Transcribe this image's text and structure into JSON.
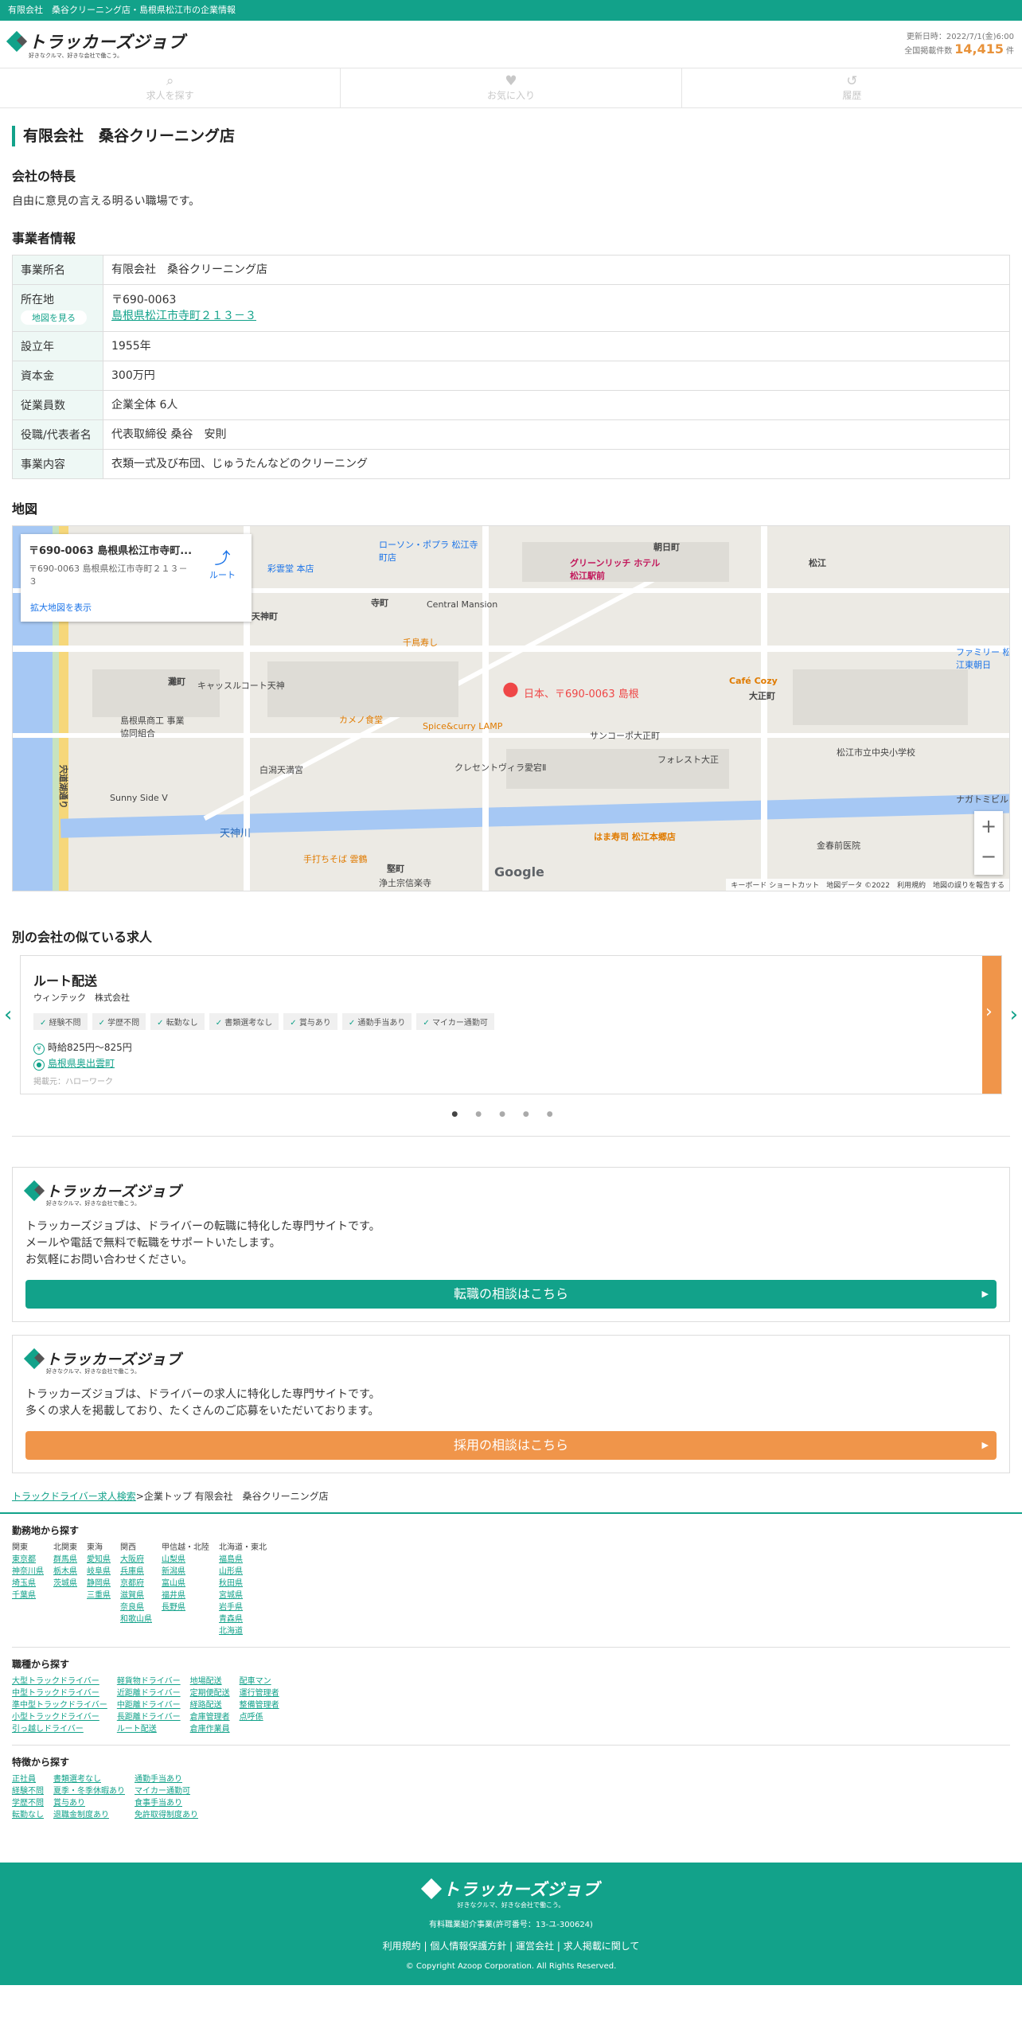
{
  "topbar": {
    "text": "有限会社　桑谷クリーニング店・島根県松江市の企業情報"
  },
  "header": {
    "logo_text": "トラッカーズジョブ",
    "logo_tagline": "好きなクルマ、好きな会社で働こう。",
    "updated": "更新日時：2022/7/1(金)6:00",
    "count_label": "全国掲載件数",
    "count": "14,415",
    "count_unit": "件"
  },
  "nav": [
    {
      "label": "求人を探す",
      "icon": "search-icon"
    },
    {
      "label": "お気に入り",
      "icon": "heart-icon"
    },
    {
      "label": "履歴",
      "icon": "history-icon"
    }
  ],
  "company": {
    "title": "有限会社　桑谷クリーニング店",
    "feature_heading": "会社の特長",
    "feature_text": "自由に意見の言える明るい職場です。",
    "info_heading": "事業者情報",
    "rows": [
      {
        "label": "事業所名",
        "value": "有限会社　桑谷クリーニング店"
      },
      {
        "label": "所在地",
        "zip": "〒690-0063",
        "address": "島根県松江市寺町２１３－３",
        "map_btn": "地図を見る"
      },
      {
        "label": "設立年",
        "value": "1955年"
      },
      {
        "label": "資本金",
        "value": "300万円"
      },
      {
        "label": "従業員数",
        "value": "企業全体 6人"
      },
      {
        "label": "役職/代表者名",
        "value": "代表取締役 桑谷　安則"
      },
      {
        "label": "事業内容",
        "value": "衣類一式及び布団、じゅうたんなどのクリーニング"
      }
    ]
  },
  "map": {
    "heading": "地図",
    "info_title": "〒690-0063 島根県松江市寺町...",
    "info_addr": "〒690-0063 島根県松江市寺町２１３－３",
    "route": "ルート",
    "enlarge": "拡大地図を表示",
    "pin_label": "日本、〒690-0063 島根",
    "footer": "キーボード ショートカット　地図データ ©2022　利用規約　地図の誤りを報告する",
    "google": "Google",
    "labels": [
      "朝日町",
      "天神町",
      "寺町",
      "灘町",
      "大正町",
      "松江",
      "Central Mansion",
      "天神川",
      "白潟天満宮",
      "Café Cozy",
      "グリーンリッチ ホテル 松江駅前",
      "ローソン・ポプラ 松江寺町店",
      "Spice&curry LAMP",
      "カメノ食堂",
      "はま寿司 松江本郷店",
      "手打ちそば 雲鶴",
      "浄土宗信楽寺",
      "宍道湖通り",
      "Sunny Side V",
      "サンコーポ大正町",
      "フォレスト大正",
      "クレセントヴィラ愛宕Ⅱ",
      "松江市立中央小学校",
      "ファミリー 松江東朝日",
      "彩雲堂 本店",
      "千鳥寿し",
      "キャッスルコート天神",
      "島根県商工 事業協同組合",
      "ナガトミビル",
      "堅町",
      "金春前医院"
    ]
  },
  "similar": {
    "heading": "別の会社の似ている求人",
    "job": "ルート配送",
    "company": "ウィンテック　株式会社",
    "tags": [
      "経験不問",
      "学歴不問",
      "転勤なし",
      "書類選考なし",
      "賞与あり",
      "通勤手当あり",
      "マイカー通勤可"
    ],
    "wage": "時給825円〜825円",
    "location": "島根県奥出雲町",
    "source": "掲載元：ハローワーク"
  },
  "promos": [
    {
      "text": [
        "トラッカーズジョブは、ドライバーの転職に特化した専門サイトです。",
        "メールや電話で無料で転職をサポートいたします。",
        "お気軽にお問い合わせください。"
      ],
      "button": "転職の相談はこちら",
      "color": "#12a28a"
    },
    {
      "text": [
        "トラッカーズジョブは、ドライバーの求人に特化した専門サイトです。",
        "多くの求人を掲載しており、たくさんのご応募をいただいております。"
      ],
      "button": "採用の相談はこちら",
      "color": "#f0954a"
    }
  ],
  "breadcrumb": {
    "link": "トラックドライバー求人検索",
    "rest": ">企業トップ 有限会社　桑谷クリーニング店"
  },
  "footnav": {
    "area": {
      "heading": "勤務地から探す",
      "cols": [
        {
          "h": "関東",
          "items": [
            "東京都",
            "神奈川県",
            "埼玉県",
            "千葉県"
          ]
        },
        {
          "h": "北関東",
          "items": [
            "群馬県",
            "栃木県",
            "茨城県"
          ]
        },
        {
          "h": "東海",
          "items": [
            "愛知県",
            "岐阜県",
            "静岡県",
            "三重県"
          ]
        },
        {
          "h": "関西",
          "items": [
            "大阪府",
            "兵庫県",
            "京都府",
            "滋賀県",
            "奈良県",
            "和歌山県"
          ]
        },
        {
          "h": "甲信越・北陸",
          "items": [
            "山梨県",
            "新潟県",
            "富山県",
            "福井県",
            "長野県"
          ]
        },
        {
          "h": "北海道・東北",
          "items": [
            "福島県",
            "山形県",
            "秋田県",
            "宮城県",
            "岩手県",
            "青森県",
            "北海道"
          ]
        }
      ]
    },
    "job": {
      "heading": "職種から探す",
      "cols": [
        {
          "items": [
            "大型トラックドライバー",
            "中型トラックドライバー",
            "準中型トラックドライバー",
            "小型トラックドライバー",
            "引っ越しドライバー"
          ]
        },
        {
          "items": [
            "軽貨物ドライバー",
            "近距離ドライバー",
            "中距離ドライバー",
            "長距離ドライバー",
            "ルート配送"
          ]
        },
        {
          "items": [
            "地場配送",
            "定期便配送",
            "経路配送",
            "倉庫管理者",
            "倉庫作業員"
          ]
        },
        {
          "items": [
            "配車マン",
            "運行管理者",
            "整備管理者",
            "点呼係"
          ]
        }
      ]
    },
    "feature": {
      "heading": "特徴から探す",
      "cols": [
        {
          "items": [
            "正社員",
            "経験不問",
            "学歴不問",
            "転勤なし"
          ]
        },
        {
          "items": [
            "書類選考なし",
            "夏季・冬季休暇あり",
            "賞与あり",
            "退職金制度あり"
          ]
        },
        {
          "items": [
            "通勤手当あり",
            "マイカー通勤可",
            "食事手当あり",
            "免許取得制度あり"
          ]
        }
      ]
    }
  },
  "footer": {
    "logo_text": "トラッカーズジョブ",
    "tagline": "好きなクルマ、好きな会社で働こう。",
    "license": "有料職業紹介事業(許可番号：13-ユ-300624)",
    "links": [
      "利用規約",
      "個人情報保護方針",
      "運営会社",
      "求人掲載に関して"
    ],
    "copyright": "© Copyright Azoop Corporation. All Rights Reserved."
  }
}
